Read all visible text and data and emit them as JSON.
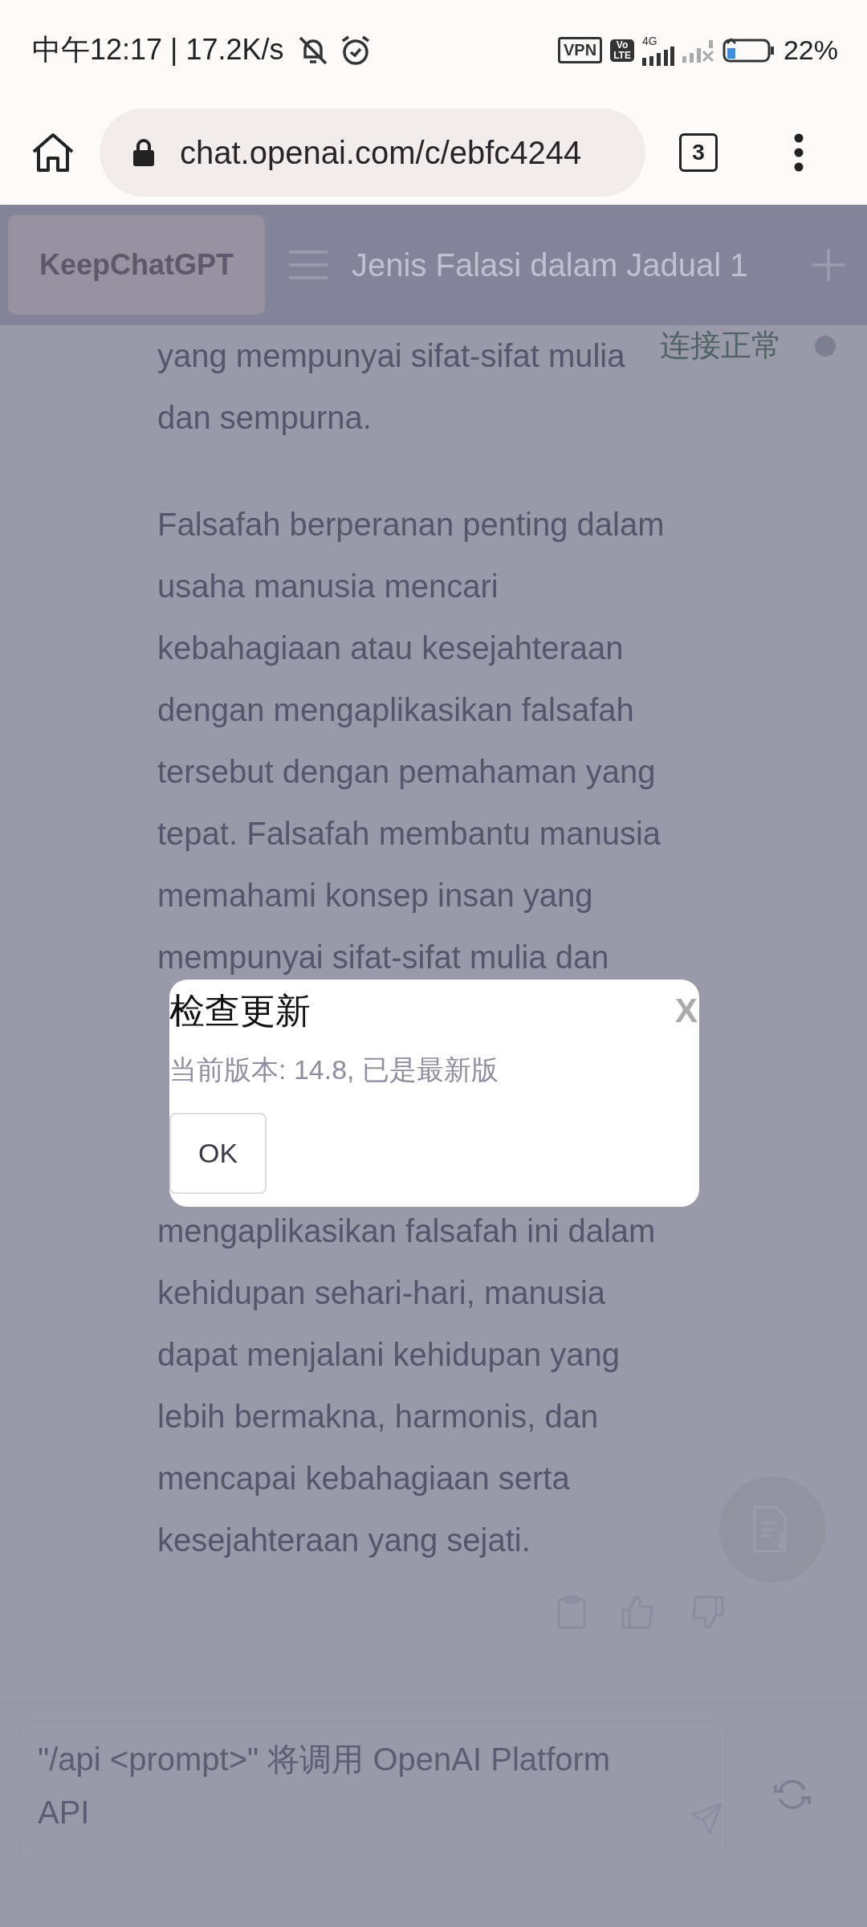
{
  "status_bar": {
    "time_and_speed": "中午12:17 | 17.2K/s",
    "vpn": "VPN",
    "volte": [
      "Vo",
      "LTE"
    ],
    "network_type": "4G",
    "battery": "22%"
  },
  "browser": {
    "url": "chat.openai.com/c/ebfc4244",
    "tab_count": "3"
  },
  "header": {
    "keep_button": "KeepChatGPT",
    "title": "Jenis Falasi dalam Jadual 1"
  },
  "connection_status": "连接正常",
  "paragraphs": [
    {
      "lines": [
        "yang mempunyai sifat-sifat mulia",
        "dan sempurna."
      ]
    },
    {
      "lines": [
        "Falsafah berperanan penting dalam",
        "usaha manusia mencari",
        "kebahagiaan atau kesejahteraan",
        "dengan mengaplikasikan falsafah",
        "tersebut dengan pemahaman yang",
        "tepat. Falsafah membantu manusia",
        "memahami konsep insan yang",
        "mempunyai sifat-sifat mulia dan"
      ]
    },
    {
      "kind": "continued",
      "lines": [
        "mengaplikasikan falsafah ini dalam",
        "kehidupan sehari-hari, manusia",
        "dapat menjalani kehidupan yang",
        "lebih bermakna, harmonis, dan",
        "mencapai kebahagiaan serta",
        "kesejahteraan yang sejati."
      ]
    }
  ],
  "composer": {
    "placeholder": "\"/api <prompt>\" 将调用 OpenAI Platform API"
  },
  "dialog": {
    "title": "检查更新",
    "close": "X",
    "message": "当前版本: 14.8, 已是最新版",
    "ok_button": "OK"
  }
}
